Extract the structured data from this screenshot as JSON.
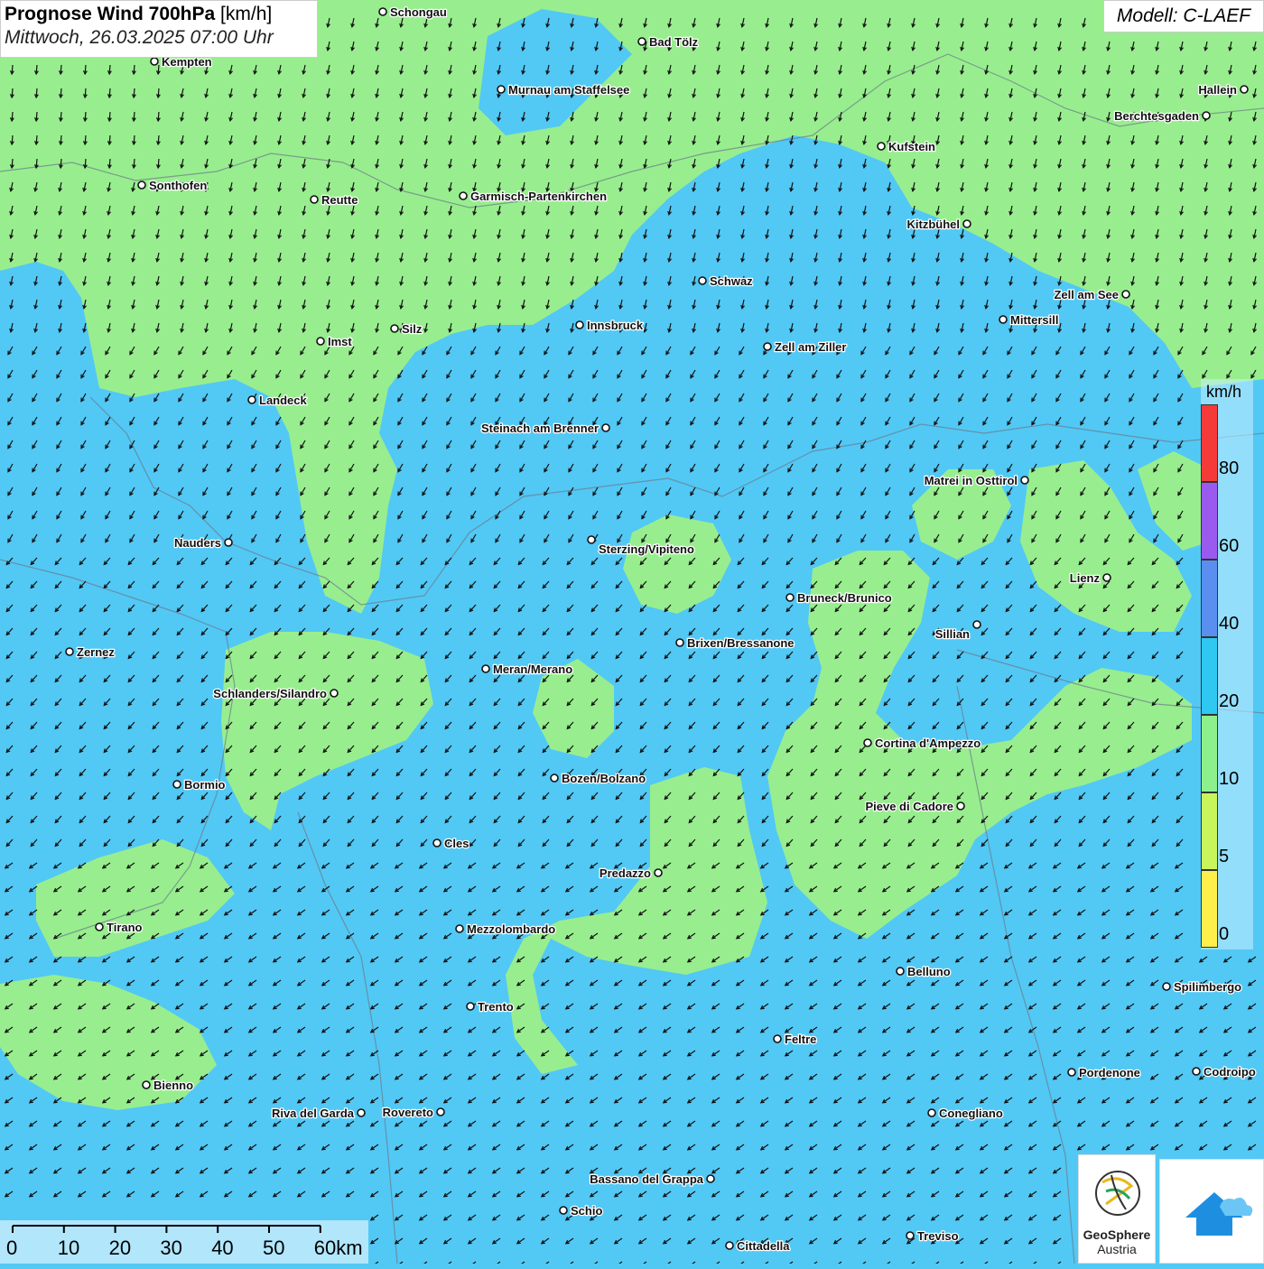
{
  "title": {
    "main": "Prognose Wind 700hPa",
    "unit": "[km/h]",
    "datetime": "Mittwoch, 26.03.2025 07:00 Uhr"
  },
  "model_label": "Modell: C-LAEF",
  "legend": {
    "unit": "km/h",
    "ticks": [
      "0",
      "5",
      "10",
      "20",
      "40",
      "60",
      "80"
    ],
    "colors": [
      "#ffef4a",
      "#c8f55a",
      "#8ef08c",
      "#2fc8f0",
      "#5a8ff0",
      "#9a5af0",
      "#f53a3a"
    ]
  },
  "scalebar": {
    "labels": [
      "0",
      "10",
      "20",
      "30",
      "40",
      "50",
      "60km"
    ]
  },
  "logos": {
    "geosphere_line1": "GeoSphere",
    "geosphere_line2": "Austria"
  },
  "colors": {
    "sea_blue": "#52c8f5",
    "calm_green": "#98ee8e"
  },
  "cities": [
    {
      "name": "Schongau"
    },
    {
      "name": "Kempten"
    },
    {
      "name": "Bad Tölz"
    },
    {
      "name": "Murnau am Staffelsee"
    },
    {
      "name": "Hallein"
    },
    {
      "name": "Berchtesgaden"
    },
    {
      "name": "Kufstein"
    },
    {
      "name": "Sonthofen"
    },
    {
      "name": "Reutte"
    },
    {
      "name": "Garmisch-Partenkirchen"
    },
    {
      "name": "Kitzbühel"
    },
    {
      "name": "Schwaz"
    },
    {
      "name": "Zell am See"
    },
    {
      "name": "Mittersill"
    },
    {
      "name": "Innsbruck"
    },
    {
      "name": "Imst"
    },
    {
      "name": "Silz"
    },
    {
      "name": "Zell am Ziller"
    },
    {
      "name": "Landeck"
    },
    {
      "name": "Steinach am Brenner"
    },
    {
      "name": "Matrei in Osttirol"
    },
    {
      "name": "Nauders"
    },
    {
      "name": "Sterzing/Vipiteno"
    },
    {
      "name": "Lienz"
    },
    {
      "name": "Bruneck/Brunico"
    },
    {
      "name": "Sillian"
    },
    {
      "name": "Zernez"
    },
    {
      "name": "Brixen/Bressanone"
    },
    {
      "name": "Meran/Merano"
    },
    {
      "name": "Schlanders/Silandro"
    },
    {
      "name": "Cortina d'Ampezzo"
    },
    {
      "name": "Bozen/Bolzano"
    },
    {
      "name": "Bormio"
    },
    {
      "name": "Pieve di Cadore"
    },
    {
      "name": "Cles"
    },
    {
      "name": "Predazzo"
    },
    {
      "name": "Tirano"
    },
    {
      "name": "Mezzolombardo"
    },
    {
      "name": "Belluno"
    },
    {
      "name": "Spilimbergo"
    },
    {
      "name": "Trento"
    },
    {
      "name": "Feltre"
    },
    {
      "name": "Pordenone"
    },
    {
      "name": "Codroipo"
    },
    {
      "name": "Bienno"
    },
    {
      "name": "Riva del Garda"
    },
    {
      "name": "Rovereto"
    },
    {
      "name": "Conegliano"
    },
    {
      "name": "Bassano del Grappa"
    },
    {
      "name": "Schio"
    },
    {
      "name": "Treviso"
    },
    {
      "name": "Cittadella"
    }
  ]
}
